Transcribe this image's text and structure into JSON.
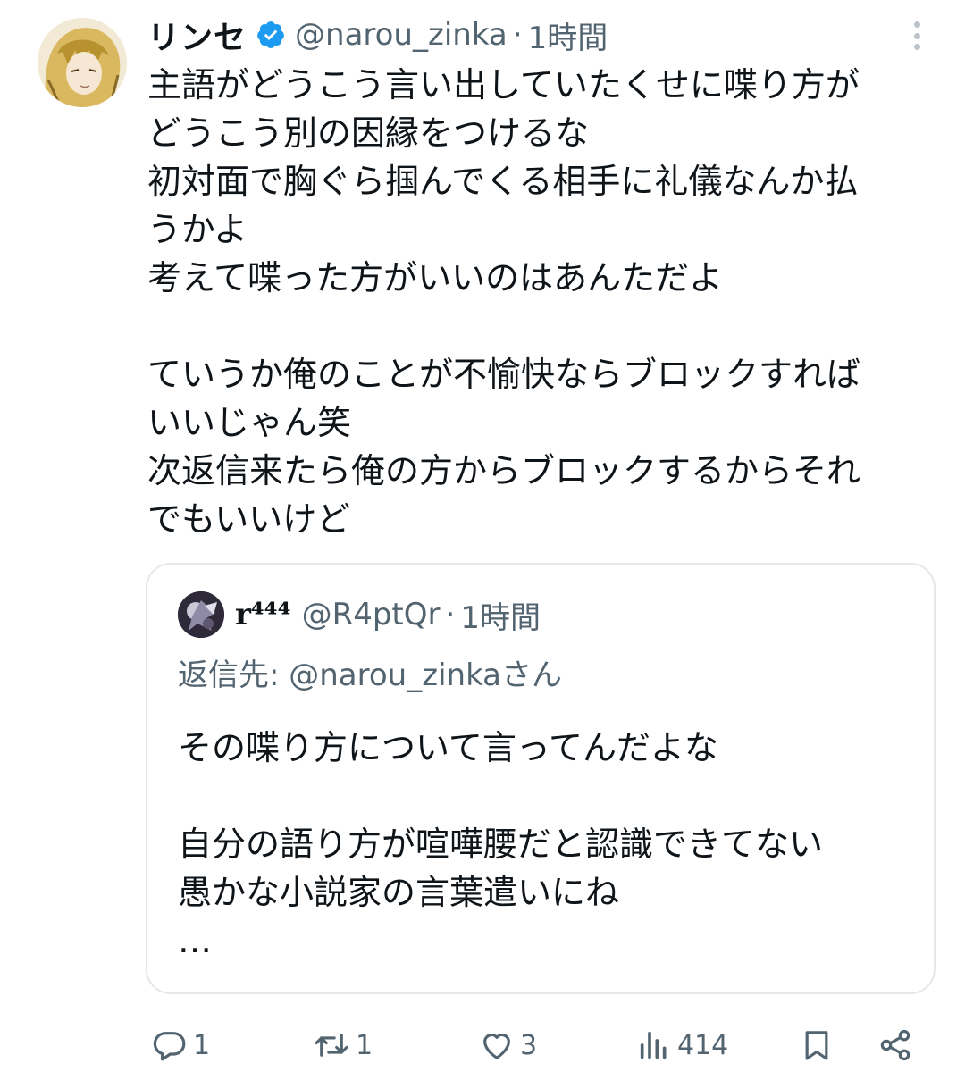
{
  "tweet": {
    "display_name": "リンセ",
    "handle": "@narou_zinka",
    "separator": "·",
    "time": "1時間",
    "lines": [
      "主語がどうこう言い出していたくせに喋り方が",
      "どうこう別の因縁をつけるな",
      "初対面で胸ぐら掴んでくる相手に礼儀なんか払",
      "うかよ",
      "考えて喋った方がいいのはあんただよ",
      "",
      "ていうか俺のことが不愉快ならブロックすれば",
      "いいじゃん笑",
      "次返信来たら俺の方からブロックするからそれ",
      "でもいいけど"
    ]
  },
  "quote": {
    "display_name": "r⁴⁴⁴",
    "handle": "@R4ptQr",
    "separator": "·",
    "time": "1時間",
    "reply_to": "返信先: @narou_zinkaさん",
    "lines": [
      "その喋り方について言ってんだよな",
      "",
      "自分の語り方が喧嘩腰だと認識できてない",
      "愚かな小説家の言葉遣いにね",
      "…"
    ]
  },
  "actions": {
    "replies": "1",
    "reposts": "1",
    "likes": "3",
    "views": "414"
  },
  "icons": {
    "verified": "verified-badge-icon",
    "more": "more-options-icon",
    "reply": "reply-icon",
    "repost": "repost-icon",
    "like": "heart-icon",
    "views": "views-bar-chart-icon",
    "bookmark": "bookmark-icon",
    "share": "share-icon"
  },
  "colors": {
    "text": "#0f1419",
    "secondary": "#536471",
    "verified": "#1d9bf0",
    "border": "#e4e8eb"
  }
}
